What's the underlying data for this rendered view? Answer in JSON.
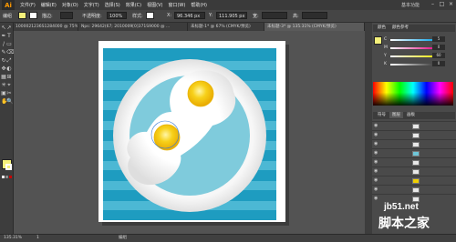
{
  "app": {
    "logo": "Ai"
  },
  "menu": [
    "文件(F)",
    "编辑(E)",
    "对象(O)",
    "文字(T)",
    "选择(S)",
    "效果(C)",
    "视图(V)",
    "窗口(W)",
    "帮助(H)"
  ],
  "workspace": "基本功能",
  "window_buttons": [
    "–",
    "□",
    "×"
  ],
  "control_bar": {
    "selection_label": "编组",
    "stroke_label": "描边:",
    "opacity_label": "不透明度:",
    "opacity_value": "100%",
    "style_label": "样式:",
    "x_label": "X:",
    "x_value": "96.346 px",
    "y_label": "Y:",
    "y_value": "111.905 px",
    "w_label": "宽:",
    "h_label": "高:",
    "fill_color": "#f5f17a",
    "stroke_color": "#ffffff"
  },
  "tabs": [
    {
      "label": "1000021236S1284000 @ 75%...",
      "active": false
    },
    {
      "label": "Nps: 29642(67; 2010009[0]371S9000 @ ...",
      "active": false
    },
    {
      "label": "未标题-1* @ 67% (CMYK/预览)",
      "active": false
    },
    {
      "label": "未标题-3* @ 135.31% (CMYK/预览)",
      "active": true
    }
  ],
  "tools": [
    "↖",
    "↗",
    "✒",
    "T",
    "/",
    "▭",
    "✎",
    "⌫",
    "↻",
    "⤢",
    "✥",
    "◐",
    "▦",
    "⊞",
    "✳",
    "⌖",
    "▣",
    "✂",
    "✋",
    "🔍"
  ],
  "fill_swatch_color": "#f5f17a",
  "right_panel": {
    "panel_tabs": [
      "颜色",
      "颜色参考"
    ],
    "sliders": [
      {
        "label": "C",
        "value": "5",
        "color": "#00a0e9"
      },
      {
        "label": "M",
        "value": "0",
        "color": "#e4007f"
      },
      {
        "label": "Y",
        "value": "60",
        "color": "#f5e900"
      },
      {
        "label": "K",
        "value": "0",
        "color": "#333333"
      }
    ],
    "layers_tabs": [
      "符号",
      "图层",
      "画板"
    ],
    "layers": [
      {
        "thumb": "#e8e8e8"
      },
      {
        "thumb": "#e8e8e8"
      },
      {
        "thumb": "#e8e8e8"
      },
      {
        "thumb": "#6ec6d8"
      },
      {
        "thumb": "#e8e8e8"
      },
      {
        "thumb": "#e8e8e8"
      },
      {
        "thumb": "#f0d000"
      },
      {
        "thumb": "#e8e8e8"
      },
      {
        "thumb": "#e8e8e8"
      },
      {
        "thumb": "#e8e8e8"
      }
    ]
  },
  "status": {
    "zoom": "135.31%",
    "page": "1",
    "tool_name": "编组"
  },
  "watermark": {
    "site": "jb51.net",
    "name": "脚本之家"
  },
  "artwork_colors": {
    "stripe_dark": "#1e9cc0",
    "stripe_light": "#4cb8d4",
    "plate": "#f2f2f2",
    "plate_inner": "#7fcbdc",
    "egg_white": "#fafafa",
    "yolk": "#f4c400"
  }
}
